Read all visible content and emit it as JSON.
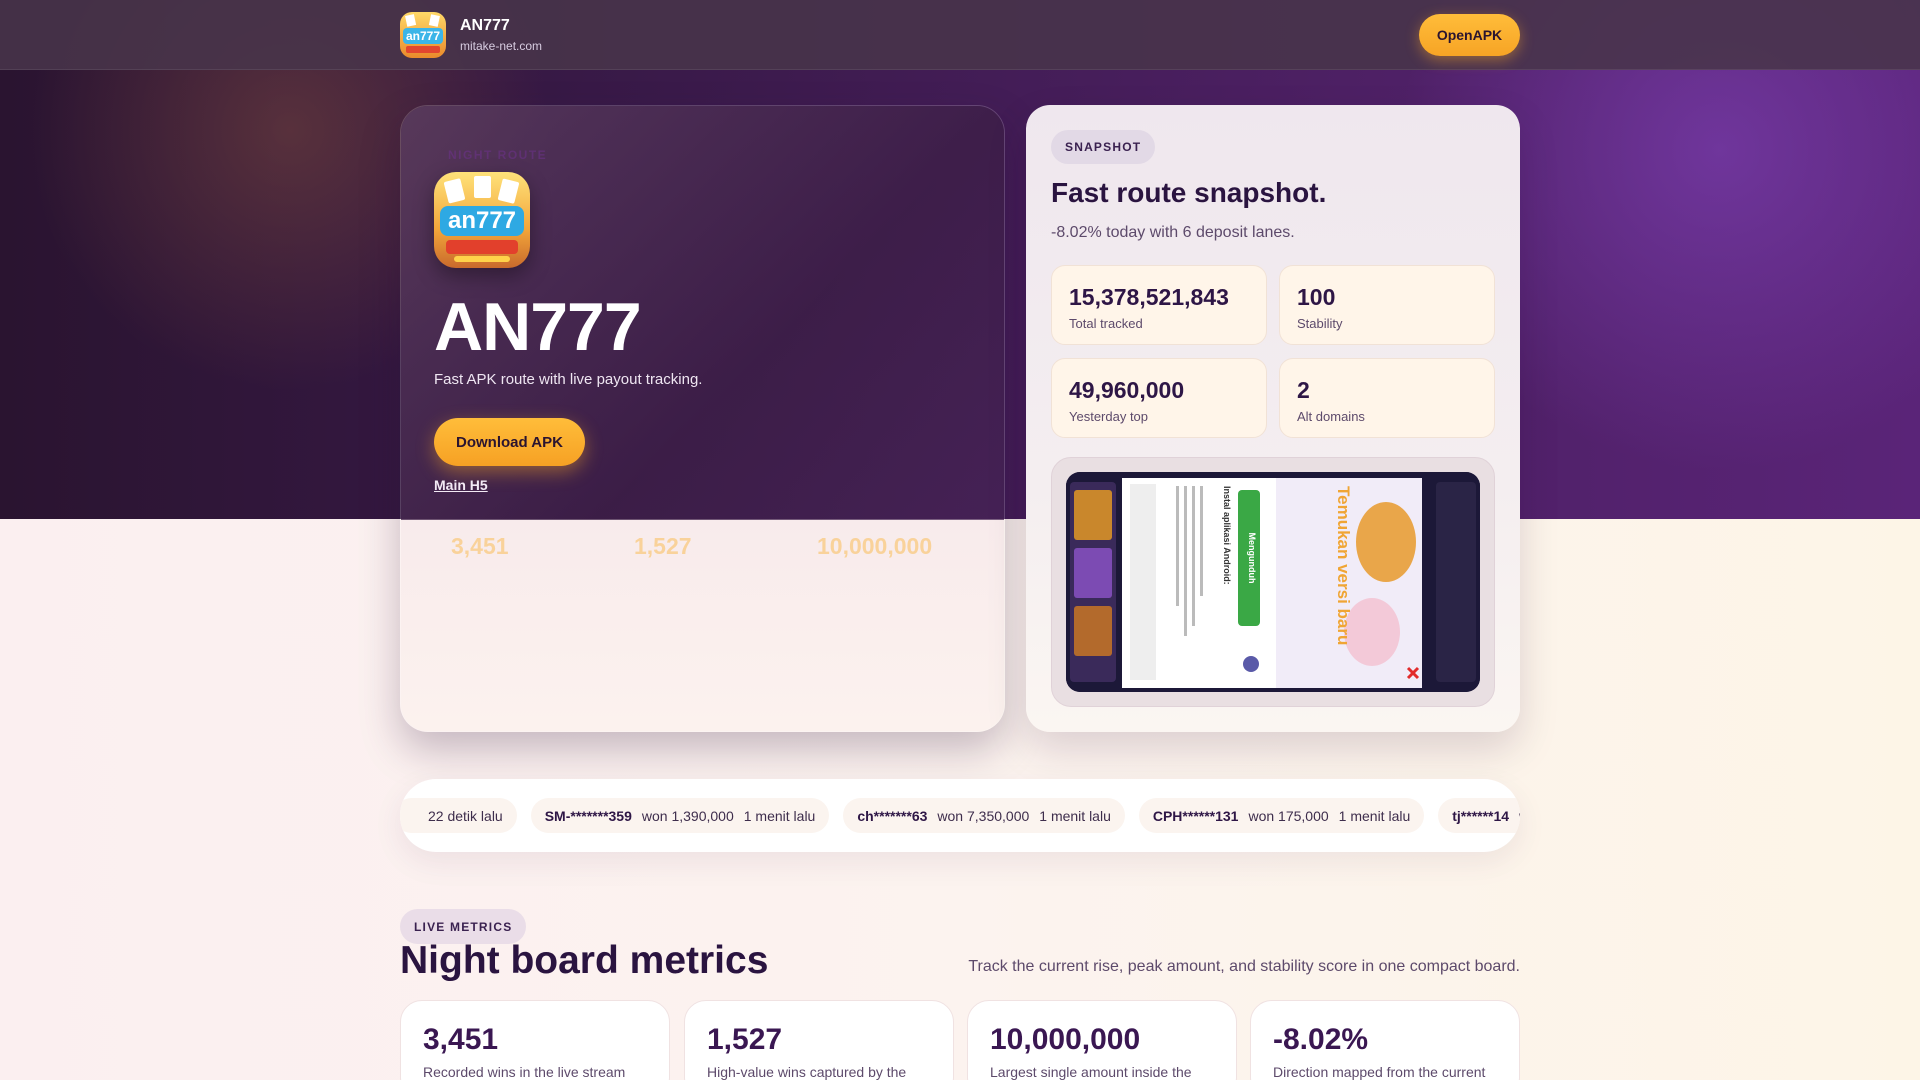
{
  "header": {
    "brand_name": "AN777",
    "brand_domain": "mitake-net.com",
    "open_apk_label": "OpenAPK"
  },
  "hero": {
    "eyebrow": "NIGHT ROUTE",
    "title": "AN777",
    "subtitle": "Fast APK route with live payout tracking.",
    "download_label": "Download APK",
    "main_h5_label": "Main H5",
    "ghost_stats": [
      "3,451",
      "1,527",
      "10,000,000"
    ]
  },
  "snapshot": {
    "tag": "SNAPSHOT",
    "title": "Fast route snapshot.",
    "subtitle": "-8.02% today with 6 deposit lanes.",
    "stats": [
      {
        "value": "15,378,521,843",
        "label": "Total tracked"
      },
      {
        "value": "100",
        "label": "Stability"
      },
      {
        "value": "49,960,000",
        "label": "Yesterday top"
      },
      {
        "value": "2",
        "label": "Alt domains"
      }
    ],
    "screenshot": {
      "dialog_title": "Instal aplikasi Android:",
      "install_button": "Mengunduh",
      "banner_text": "Temukan versi baru"
    }
  },
  "ticker": {
    "items": [
      {
        "user": "",
        "amount": "",
        "time": "22 detik lalu"
      },
      {
        "user": "SM-*******359",
        "amount": "won 1,390,000",
        "time": "1 menit lalu"
      },
      {
        "user": "ch*******63",
        "amount": "won 7,350,000",
        "time": "1 menit lalu"
      },
      {
        "user": "CPH******131",
        "amount": "won 175,000",
        "time": "1 menit lalu"
      },
      {
        "user": "tj******14",
        "amount": "w",
        "time": ""
      }
    ]
  },
  "live_metrics": {
    "tag": "LIVE METRICS",
    "title": "Night board metrics",
    "description": "Track the current rise, peak amount, and stability score in one compact board.",
    "cards": [
      {
        "value": "3,451",
        "desc": "Recorded wins in the live stream"
      },
      {
        "value": "1,527",
        "desc": "High-value wins captured by the"
      },
      {
        "value": "10,000,000",
        "desc": "Largest single amount inside the"
      },
      {
        "value": "-8.02%",
        "desc": "Direction mapped from the current"
      }
    ]
  },
  "colors": {
    "accent": "#f7a425",
    "deep_purple": "#2a1440",
    "card_cream": "#fff5e9"
  }
}
